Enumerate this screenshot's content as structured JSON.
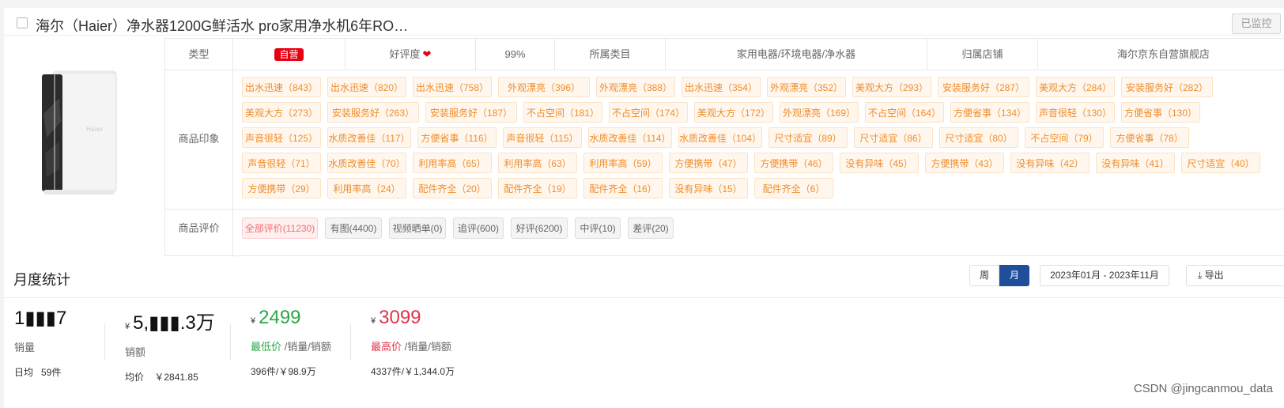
{
  "title": {
    "text": "海尔（Haier）净水器1200G鲜活水 pro家用净水机6年RO…",
    "monitor_label": "已监控"
  },
  "attrs": {
    "type_label": "类型",
    "type_value": "自营",
    "rating_label": "好评度",
    "rating_value": "99%",
    "category_label": "所属类目",
    "category_value": "家用电器/环境电器/净水器",
    "shop_label": "归属店铺",
    "shop_value": "海尔京东自营旗舰店"
  },
  "impressions": {
    "label": "商品印象",
    "tags": [
      "出水迅速（843）",
      "出水迅速（820）",
      "出水迅速（758）",
      "外观漂亮（396）",
      "外观漂亮（388）",
      "出水迅速（354）",
      "外观漂亮（352）",
      "美观大方（293）",
      "安装服务好（287）",
      "美观大方（284）",
      "安装服务好（282）",
      "美观大方（273）",
      "安装服务好（263）",
      "安装服务好（187）",
      "不占空间（181）",
      "不占空间（174）",
      "美观大方（172）",
      "外观漂亮（169）",
      "不占空间（164）",
      "方便省事（134）",
      "声音很轻（130）",
      "方便省事（130）",
      "声音很轻（125）",
      "水质改善佳（117）",
      "方便省事（116）",
      "声音很轻（115）",
      "水质改善佳（114）",
      "水质改善佳（104）",
      "尺寸适宜（89）",
      "尺寸适宜（86）",
      "尺寸适宜（80）",
      "不占空间（79）",
      "方便省事（78）",
      "声音很轻（71）",
      "水质改善佳（70）",
      "利用率高（65）",
      "利用率高（63）",
      "利用率高（59）",
      "方便携带（47）",
      "方便携带（46）",
      "没有异味（45）",
      "方便携带（43）",
      "没有异味（42）",
      "没有异味（41）",
      "尺寸适宜（40）",
      "方便携带（29）",
      "利用率高（24）",
      "配件齐全（20）",
      "配件齐全（19）",
      "配件齐全（16）",
      "没有异味（15）",
      "配件齐全（6）"
    ]
  },
  "reviews": {
    "label": "商品评价",
    "tags": [
      "全部评价(11230)",
      "有图(4400)",
      "视频晒单(0)",
      "追评(600)",
      "好评(6200)",
      "中评(10)",
      "差评(20)"
    ]
  },
  "monthly": {
    "title": "月度统计",
    "week": "周",
    "month": "月",
    "range": "2023年01月 - 2023年11月",
    "export": "导出",
    "sales_value": "1▮▮▮7",
    "sales_label": "销量",
    "daily_label": "日均",
    "daily_value": "59件",
    "amount_cur": "¥",
    "amount_value": "5,▮▮▮.3万",
    "amount_label": "销额",
    "avg_label": "均价",
    "avg_value": "￥2841.85",
    "low_cur": "¥",
    "low_value": "2499",
    "low_label": "最低价",
    "low_suffix": " /销量/销额",
    "low_detail": "396件/￥98.9万",
    "high_cur": "¥",
    "high_value": "3099",
    "high_label": "最高价",
    "high_suffix": " /销量/销额",
    "high_detail": "4337件/￥1,344.0万"
  },
  "watermark": "CSDN @jingcanmou_data"
}
